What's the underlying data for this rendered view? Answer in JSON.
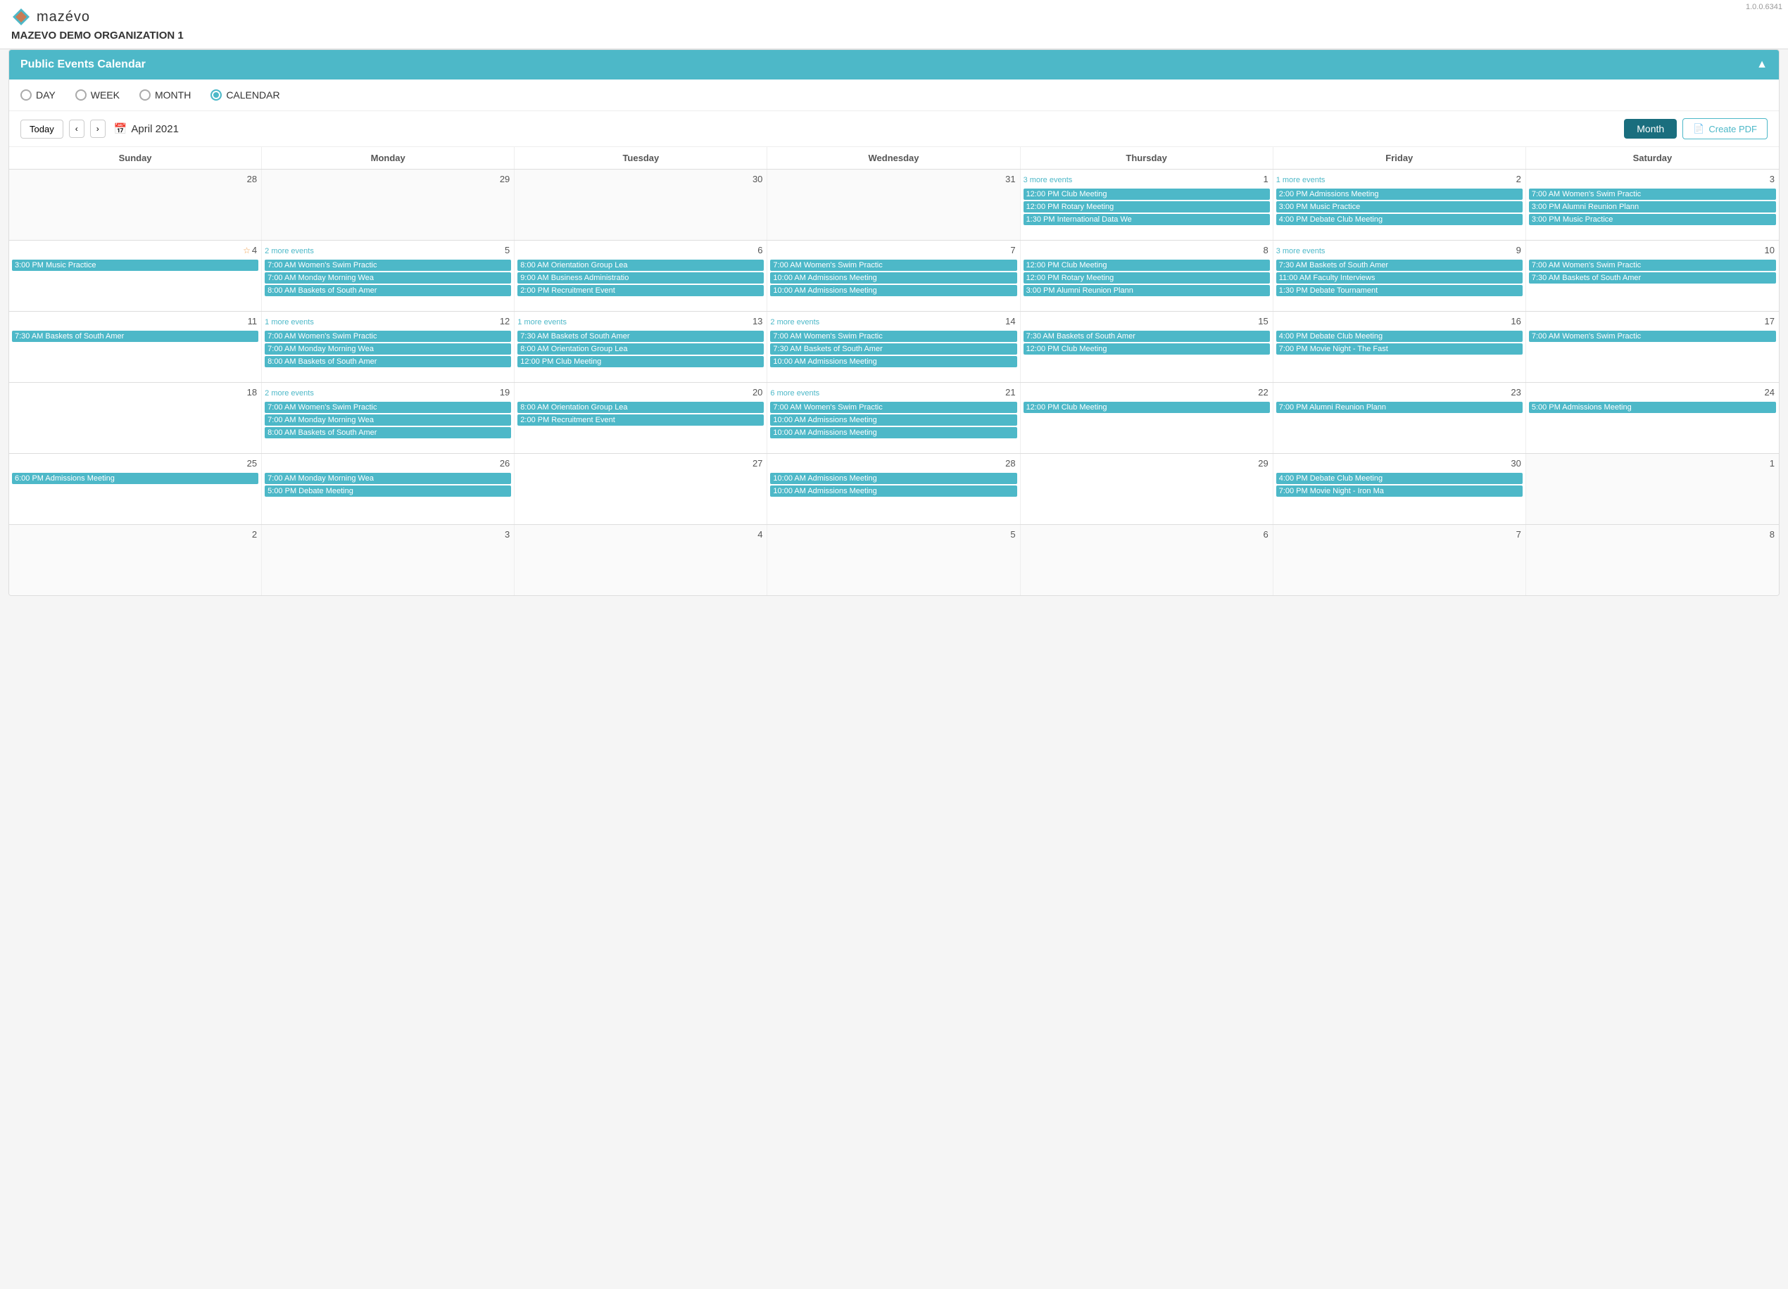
{
  "version": "1.0.0.6341",
  "logo": {
    "text": "mazévo"
  },
  "org_name": "MAZEVO DEMO ORGANIZATION 1",
  "panel": {
    "title": "Public Events Calendar",
    "collapse_label": "▲"
  },
  "view_options": [
    {
      "id": "day",
      "label": "DAY",
      "active": false
    },
    {
      "id": "week",
      "label": "WEEK",
      "active": false
    },
    {
      "id": "month",
      "label": "MONTH",
      "active": false
    },
    {
      "id": "calendar",
      "label": "CALENDAR",
      "active": true
    }
  ],
  "toolbar": {
    "today_label": "Today",
    "prev_label": "‹",
    "next_label": "›",
    "current_month": "April 2021",
    "month_button": "Month",
    "create_pdf_label": "Create PDF"
  },
  "day_headers": [
    "Sunday",
    "Monday",
    "Tuesday",
    "Wednesday",
    "Thursday",
    "Friday",
    "Saturday"
  ],
  "weeks": [
    {
      "days": [
        {
          "num": "28",
          "other": true,
          "star": false,
          "more": null,
          "events": []
        },
        {
          "num": "29",
          "other": true,
          "star": false,
          "more": null,
          "events": []
        },
        {
          "num": "30",
          "other": true,
          "star": false,
          "more": null,
          "events": []
        },
        {
          "num": "31",
          "other": true,
          "star": false,
          "more": null,
          "events": []
        },
        {
          "num": "1",
          "other": false,
          "star": false,
          "more": "3 more events",
          "events": [
            "12:00 PM  Club Meeting",
            "12:00 PM  Rotary Meeting",
            "1:30 PM  International Data We"
          ]
        },
        {
          "num": "2",
          "other": false,
          "star": false,
          "more": "1 more events",
          "events": [
            "2:00 PM  Admissions Meeting",
            "3:00 PM  Music Practice",
            "4:00 PM  Debate Club Meeting"
          ]
        },
        {
          "num": "3",
          "other": false,
          "star": false,
          "more": null,
          "events": [
            "7:00 AM  Women's Swim Practic",
            "3:00 PM  Alumni Reunion Plann",
            "3:00 PM  Music Practice"
          ]
        }
      ]
    },
    {
      "days": [
        {
          "num": "4",
          "other": false,
          "star": true,
          "more": null,
          "events": [
            "3:00 PM  Music Practice"
          ]
        },
        {
          "num": "5",
          "other": false,
          "star": false,
          "more": "2 more events",
          "events": [
            "7:00 AM  Women's Swim Practic",
            "7:00 AM  Monday Morning Wea",
            "8:00 AM  Baskets of South Amer"
          ]
        },
        {
          "num": "6",
          "other": false,
          "star": false,
          "more": null,
          "events": [
            "8:00 AM  Orientation Group Lea",
            "9:00 AM  Business Administratio",
            "2:00 PM  Recruitment Event"
          ]
        },
        {
          "num": "7",
          "other": false,
          "star": false,
          "more": null,
          "events": [
            "7:00 AM  Women's Swim Practic",
            "10:00 AM  Admissions Meeting",
            "10:00 AM  Admissions Meeting"
          ]
        },
        {
          "num": "8",
          "other": false,
          "star": false,
          "more": null,
          "events": [
            "12:00 PM  Club Meeting",
            "12:00 PM  Rotary Meeting",
            "3:00 PM  Alumni Reunion Plann"
          ]
        },
        {
          "num": "9",
          "other": false,
          "star": false,
          "more": "3 more events",
          "events": [
            "7:30 AM  Baskets of South Amer",
            "11:00 AM  Faculty Interviews",
            "1:30 PM  Debate Tournament"
          ]
        },
        {
          "num": "10",
          "other": false,
          "star": false,
          "more": null,
          "events": [
            "7:00 AM  Women's Swim Practic",
            "7:30 AM  Baskets of South Amer"
          ]
        }
      ]
    },
    {
      "days": [
        {
          "num": "11",
          "other": false,
          "star": false,
          "more": null,
          "events": [
            "7:30 AM  Baskets of South Amer"
          ]
        },
        {
          "num": "12",
          "other": false,
          "star": false,
          "more": "1 more events",
          "events": [
            "7:00 AM  Women's Swim Practic",
            "7:00 AM  Monday Morning Wea",
            "8:00 AM  Baskets of South Amer"
          ]
        },
        {
          "num": "13",
          "other": false,
          "star": false,
          "more": "1 more events",
          "events": [
            "7:30 AM  Baskets of South Amer",
            "8:00 AM  Orientation Group Lea",
            "12:00 PM  Club Meeting"
          ]
        },
        {
          "num": "14",
          "other": false,
          "star": false,
          "more": "2 more events",
          "events": [
            "7:00 AM  Women's Swim Practic",
            "7:30 AM  Baskets of South Amer",
            "10:00 AM  Admissions Meeting"
          ]
        },
        {
          "num": "15",
          "other": false,
          "star": false,
          "more": null,
          "events": [
            "7:30 AM  Baskets of South Amer",
            "12:00 PM  Club Meeting"
          ]
        },
        {
          "num": "16",
          "other": false,
          "star": false,
          "more": null,
          "events": [
            "4:00 PM  Debate Club Meeting",
            "7:00 PM  Movie Night - The Fast"
          ]
        },
        {
          "num": "17",
          "other": false,
          "star": false,
          "more": null,
          "events": [
            "7:00 AM  Women's Swim Practic"
          ]
        }
      ]
    },
    {
      "days": [
        {
          "num": "18",
          "other": false,
          "star": false,
          "more": null,
          "events": []
        },
        {
          "num": "19",
          "other": false,
          "star": false,
          "more": "2 more events",
          "events": [
            "7:00 AM  Women's Swim Practic",
            "7:00 AM  Monday Morning Wea",
            "8:00 AM  Baskets of South Amer"
          ]
        },
        {
          "num": "20",
          "other": false,
          "star": false,
          "more": null,
          "events": [
            "8:00 AM  Orientation Group Lea",
            "2:00 PM  Recruitment Event"
          ]
        },
        {
          "num": "21",
          "other": false,
          "star": false,
          "more": "6 more events",
          "events": [
            "7:00 AM  Women's Swim Practic",
            "10:00 AM  Admissions Meeting",
            "10:00 AM  Admissions Meeting"
          ]
        },
        {
          "num": "22",
          "other": false,
          "star": false,
          "more": null,
          "events": [
            "12:00 PM  Club Meeting"
          ]
        },
        {
          "num": "23",
          "other": false,
          "star": false,
          "more": null,
          "events": [
            "7:00 PM  Alumni Reunion Plann"
          ]
        },
        {
          "num": "24",
          "other": false,
          "star": false,
          "more": null,
          "events": [
            "5:00 PM  Admissions Meeting"
          ]
        }
      ]
    },
    {
      "days": [
        {
          "num": "25",
          "other": false,
          "star": false,
          "more": null,
          "events": [
            "6:00 PM  Admissions Meeting"
          ]
        },
        {
          "num": "26",
          "other": false,
          "star": false,
          "more": null,
          "events": [
            "7:00 AM  Monday Morning Wea",
            "5:00 PM  Debate Meeting"
          ]
        },
        {
          "num": "27",
          "other": false,
          "star": false,
          "more": null,
          "events": []
        },
        {
          "num": "28",
          "other": false,
          "star": false,
          "more": null,
          "events": [
            "10:00 AM  Admissions Meeting",
            "10:00 AM  Admissions Meeting"
          ]
        },
        {
          "num": "29",
          "other": false,
          "star": false,
          "more": null,
          "events": []
        },
        {
          "num": "30",
          "other": false,
          "star": false,
          "more": null,
          "events": [
            "4:00 PM  Debate Club Meeting",
            "7:00 PM  Movie Night - Iron Ma"
          ]
        },
        {
          "num": "1",
          "other": true,
          "star": false,
          "more": null,
          "events": []
        }
      ]
    },
    {
      "days": [
        {
          "num": "2",
          "other": true,
          "star": false,
          "more": null,
          "events": []
        },
        {
          "num": "3",
          "other": true,
          "star": false,
          "more": null,
          "events": []
        },
        {
          "num": "4",
          "other": true,
          "star": false,
          "more": null,
          "events": []
        },
        {
          "num": "5",
          "other": true,
          "star": false,
          "more": null,
          "events": []
        },
        {
          "num": "6",
          "other": true,
          "star": false,
          "more": null,
          "events": []
        },
        {
          "num": "7",
          "other": true,
          "star": false,
          "more": null,
          "events": []
        },
        {
          "num": "8",
          "other": true,
          "star": false,
          "more": null,
          "events": []
        }
      ]
    }
  ]
}
